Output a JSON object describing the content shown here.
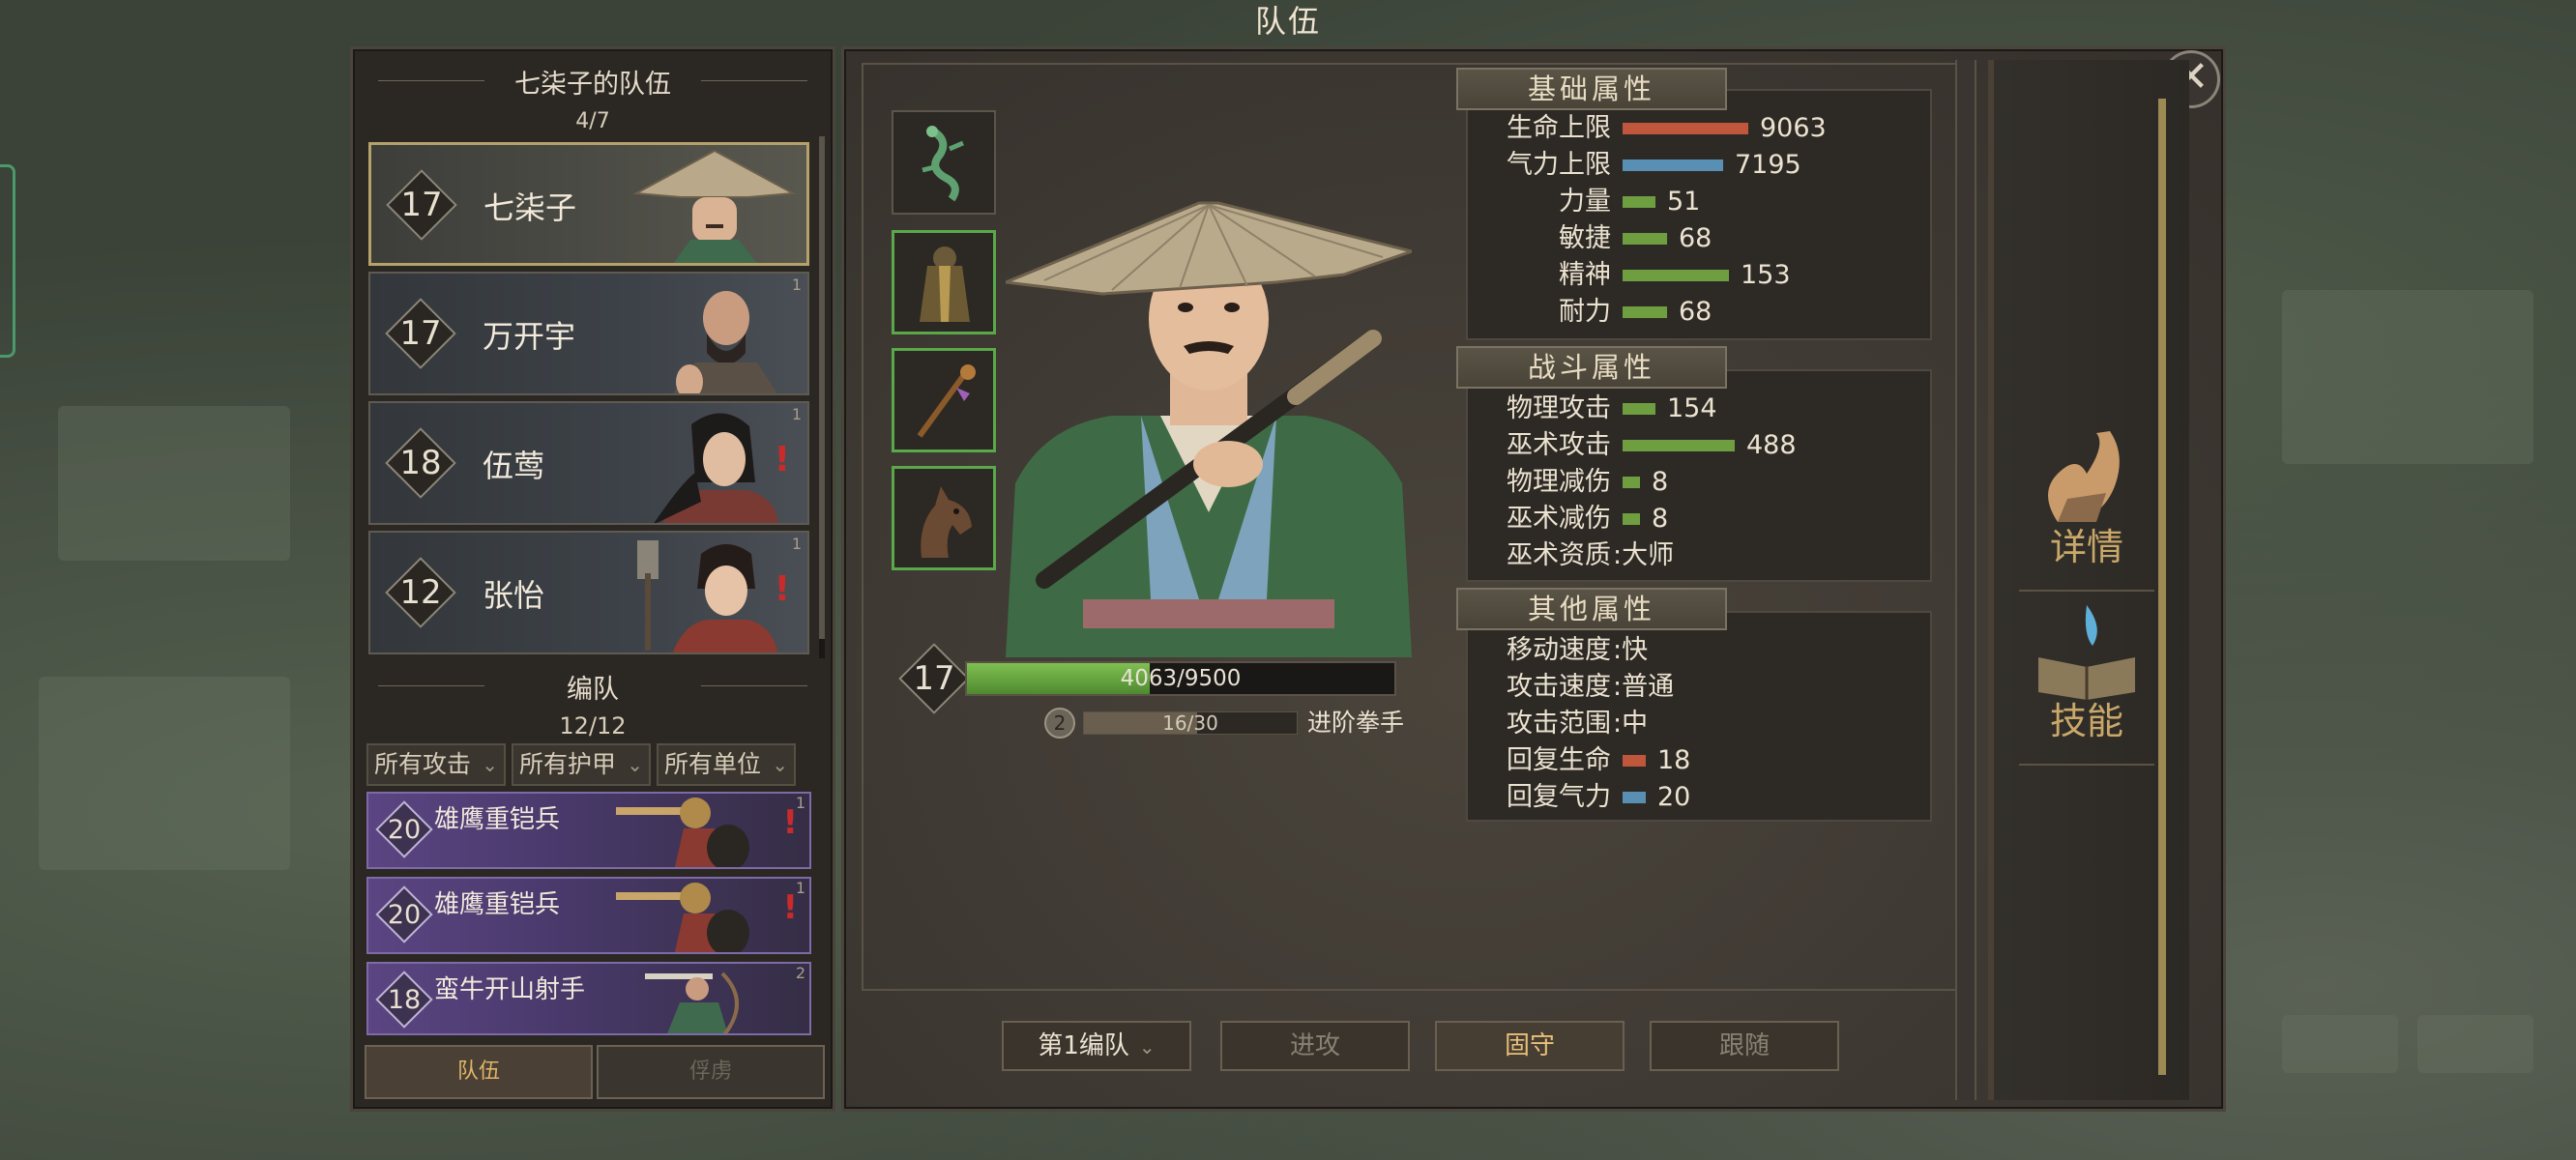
{
  "window_title": "队伍",
  "team_panel": {
    "title": "七柒子的队伍",
    "count": "4/7",
    "heroes": [
      {
        "level": "17",
        "name": "七柒子",
        "index": "",
        "alert": false,
        "selected": true
      },
      {
        "level": "17",
        "name": "万开宇",
        "index": "1",
        "alert": false,
        "selected": false
      },
      {
        "level": "18",
        "name": "伍莺",
        "index": "1",
        "alert": true,
        "selected": false
      },
      {
        "level": "12",
        "name": "张怡",
        "index": "1",
        "alert": true,
        "selected": false
      }
    ],
    "formation_title": "编队",
    "formation_count": "12/12",
    "filters": [
      "所有攻击",
      "所有护甲",
      "所有单位"
    ],
    "units": [
      {
        "level": "20",
        "name": "雄鹰重铠兵",
        "index": "1",
        "alert": true
      },
      {
        "level": "20",
        "name": "雄鹰重铠兵",
        "index": "1",
        "alert": true
      },
      {
        "level": "18",
        "name": "蛮牛开山射手",
        "index": "2",
        "alert": false
      }
    ],
    "tabs": [
      "队伍",
      "俘虏"
    ]
  },
  "character": {
    "level": "17",
    "hp_text": "4063/9500",
    "hp_fraction": 0.4277,
    "rank_badge": "2",
    "xp_text": "16/30",
    "xp_fraction": 0.533,
    "rank_name": "进阶拳手"
  },
  "basic_attrs": {
    "title": "基础属性",
    "rows": [
      {
        "label": "生命上限",
        "value": "9063",
        "color": "#c0563c",
        "bar": 130
      },
      {
        "label": "气力上限",
        "value": "7195",
        "color": "#5a8fb4",
        "bar": 104
      },
      {
        "label": "力量",
        "value": "51",
        "color": "#6e9e3f",
        "bar": 34
      },
      {
        "label": "敏捷",
        "value": "68",
        "color": "#6e9e3f",
        "bar": 46
      },
      {
        "label": "精神",
        "value": "153",
        "color": "#6e9e3f",
        "bar": 110
      },
      {
        "label": "耐力",
        "value": "68",
        "color": "#6e9e3f",
        "bar": 46
      }
    ]
  },
  "combat_attrs": {
    "title": "战斗属性",
    "rows": [
      {
        "label": "物理攻击",
        "value": "154",
        "color": "#6e9e3f",
        "bar": 34
      },
      {
        "label": "巫术攻击",
        "value": "488",
        "color": "#6e9e3f",
        "bar": 116
      },
      {
        "label": "物理减伤",
        "value": "8",
        "color": "#6e9e3f",
        "bar": 18
      },
      {
        "label": "巫术减伤",
        "value": "8",
        "color": "#6e9e3f",
        "bar": 18
      },
      {
        "label": "巫术资质",
        "value": ":大师",
        "color": "",
        "bar": 0
      }
    ]
  },
  "other_attrs": {
    "title": "其他属性",
    "rows": [
      {
        "label": "移动速度",
        "value": ":快",
        "color": "",
        "bar": 0
      },
      {
        "label": "攻击速度",
        "value": ":普通",
        "color": "",
        "bar": 0
      },
      {
        "label": "攻击范围",
        "value": ":中",
        "color": "",
        "bar": 0
      },
      {
        "label": "回复生命",
        "value": "18",
        "color": "#c0563c",
        "bar": 24
      },
      {
        "label": "回复气力",
        "value": "20",
        "color": "#5a8fb4",
        "bar": 24
      }
    ]
  },
  "bottom_buttons": {
    "formation_select": "第1编队",
    "attack": "进攻",
    "defend": "固守",
    "follow": "跟随"
  },
  "side_menu": {
    "details": "详情",
    "skills": "技能"
  },
  "icons": [
    "close-icon",
    "dragon-charm-icon",
    "robe-armor-icon",
    "staff-weapon-icon",
    "horse-mount-icon",
    "muscle-arm-icon",
    "skill-book-icon",
    "chevron-down-icon"
  ]
}
